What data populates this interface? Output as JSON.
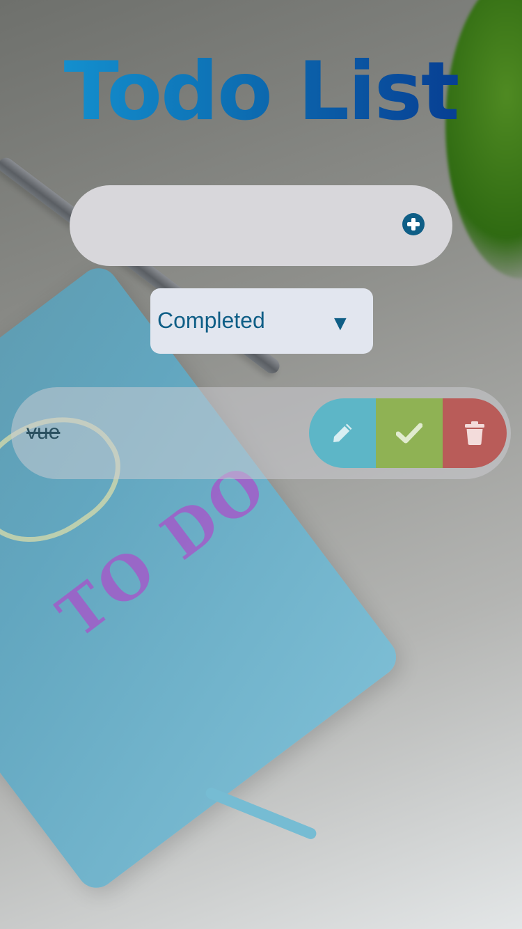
{
  "app": {
    "title": "Todo List"
  },
  "add_form": {
    "input_value": "",
    "input_placeholder": "",
    "add_icon": "plus-circle-icon"
  },
  "filter": {
    "selected": "Completed",
    "arrow": "▼"
  },
  "todos": [
    {
      "text": "vue",
      "completed": true,
      "actions": {
        "edit_icon": "pencil-icon",
        "complete_icon": "check-icon",
        "delete_icon": "trash-icon"
      }
    }
  ],
  "colors": {
    "title_gradient_start": "#169bd8",
    "title_gradient_end": "#05318a",
    "accent": "#0f5e86",
    "edit": "#5db6c7",
    "complete": "#8fb254",
    "delete": "#b95c59"
  }
}
